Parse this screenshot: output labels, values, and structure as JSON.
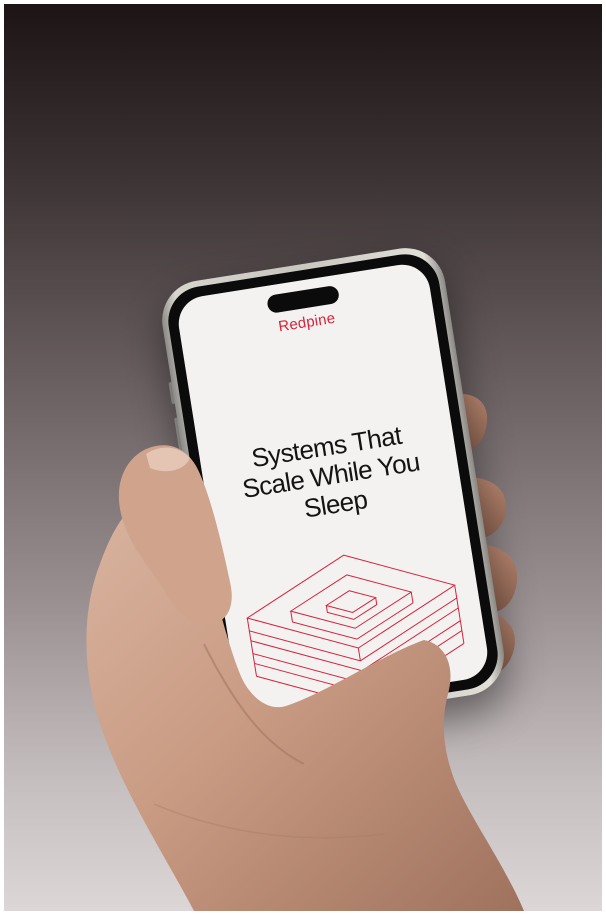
{
  "app": {
    "brand": "Redpine",
    "headline_lines": [
      "Systems That",
      "Scale While You",
      "Sleep"
    ]
  },
  "colors": {
    "brand_red": "#d4243a",
    "screen_bg": "#f4f2f1",
    "text_dark": "#141414",
    "background_top": "#1c1415",
    "background_bottom": "#dcd6d6"
  },
  "illustration": {
    "type": "nested-square-frames",
    "layers": 4,
    "icon": "stacked-frames-icon"
  }
}
